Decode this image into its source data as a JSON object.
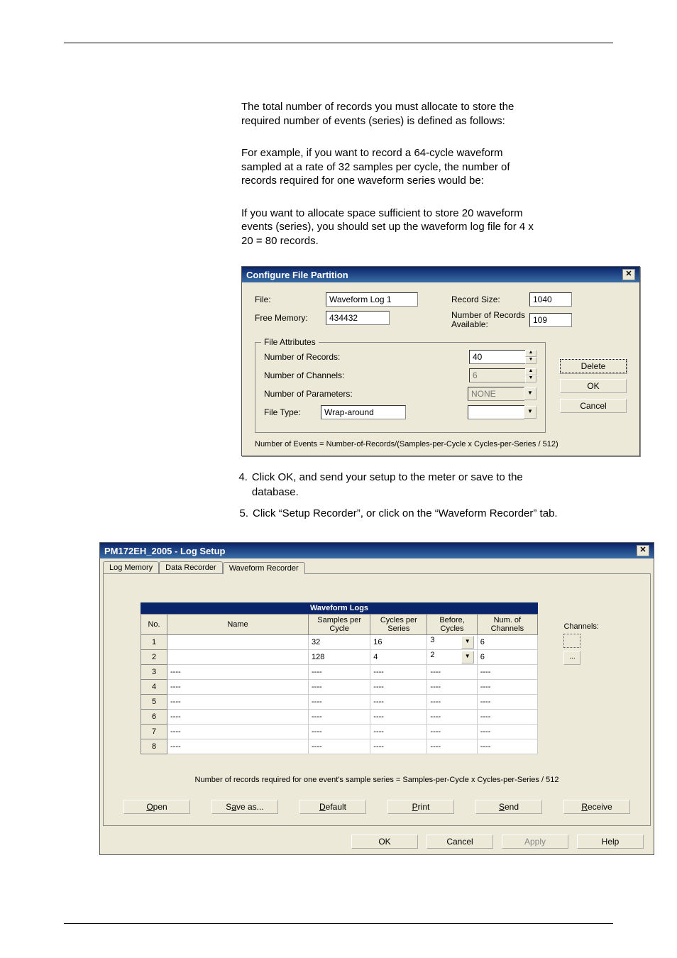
{
  "para1": "The total number of records you must allocate to store the required number of events (series) is defined as follows:",
  "para2": "For example, if you want to record a 64-cycle waveform sampled at a rate of 32 samples per cycle, the number of records required for one waveform series would be:",
  "para3": "If you want to allocate space sufficient to store 20 waveform events (series), you should set up the waveform log file for 4 x 20 = 80 records.",
  "cfp": {
    "title": "Configure File Partition",
    "file_lbl": "File:",
    "file_val": "Waveform Log 1",
    "free_lbl": "Free Memory:",
    "free_val": "434432",
    "recsize_lbl": "Record Size:",
    "recsize_val": "1040",
    "navail_lbl": "Number of Records Available:",
    "navail_val": "109",
    "fa_legend": "File Attributes",
    "nrec_lbl": "Number of Records:",
    "nrec_val": "40",
    "nchan_lbl": "Number of Channels:",
    "nchan_val": "6",
    "nparam_lbl": "Number of Parameters:",
    "nparam_val": "NONE",
    "ftype_lbl": "File Type:",
    "ftype_val": "Wrap-around",
    "delete_btn": "Delete",
    "ok_btn": "OK",
    "cancel_btn": "Cancel",
    "formula": "Number of Events = Number-of-Records/(Samples-per-Cycle x Cycles-per-Series / 512)"
  },
  "step4_num": "4.",
  "step4_txt": "Click OK, and send your setup to the meter or save to the database.",
  "step5_num": "5.",
  "step5_txt": "Click “Setup Recorder”, or click on the “Waveform Recorder” tab.",
  "log": {
    "title": "PM172EH_2005 - Log Setup",
    "tabs": {
      "t1": "Log Memory",
      "t2": "Data Recorder",
      "t3": "Waveform Recorder"
    },
    "header": "Waveform Logs",
    "cols": {
      "no": "No.",
      "name": "Name",
      "spc": "Samples per Cycle",
      "cps": "Cycles per Series",
      "bc": "Before, Cycles",
      "nc": "Num. of Channels",
      "ch": "Channels:"
    },
    "rows": [
      {
        "no": "1",
        "name": "",
        "spc": "32",
        "cps": "16",
        "bc": "3",
        "nc": "6"
      },
      {
        "no": "2",
        "name": "",
        "spc": "128",
        "cps": "4",
        "bc": "2",
        "nc": "6"
      },
      {
        "no": "3",
        "name": "----",
        "spc": "----",
        "cps": "----",
        "bc": "----",
        "nc": "----"
      },
      {
        "no": "4",
        "name": "----",
        "spc": "----",
        "cps": "----",
        "bc": "----",
        "nc": "----"
      },
      {
        "no": "5",
        "name": "----",
        "spc": "----",
        "cps": "----",
        "bc": "----",
        "nc": "----"
      },
      {
        "no": "6",
        "name": "----",
        "spc": "----",
        "cps": "----",
        "bc": "----",
        "nc": "----"
      },
      {
        "no": "7",
        "name": "----",
        "spc": "----",
        "cps": "----",
        "bc": "----",
        "nc": "----"
      },
      {
        "no": "8",
        "name": "----",
        "spc": "----",
        "cps": "----",
        "bc": "----",
        "nc": "----"
      }
    ],
    "note": "Number of records required for one event's sample series = Samples-per-Cycle x Cycles-per-Series / 512",
    "btns": {
      "open": "Open",
      "save": "Save as...",
      "default": "Default",
      "print": "Print",
      "send": "Send",
      "receive": "Receive"
    },
    "footer": {
      "ok": "OK",
      "cancel": "Cancel",
      "apply": "Apply",
      "help": "Help"
    }
  }
}
